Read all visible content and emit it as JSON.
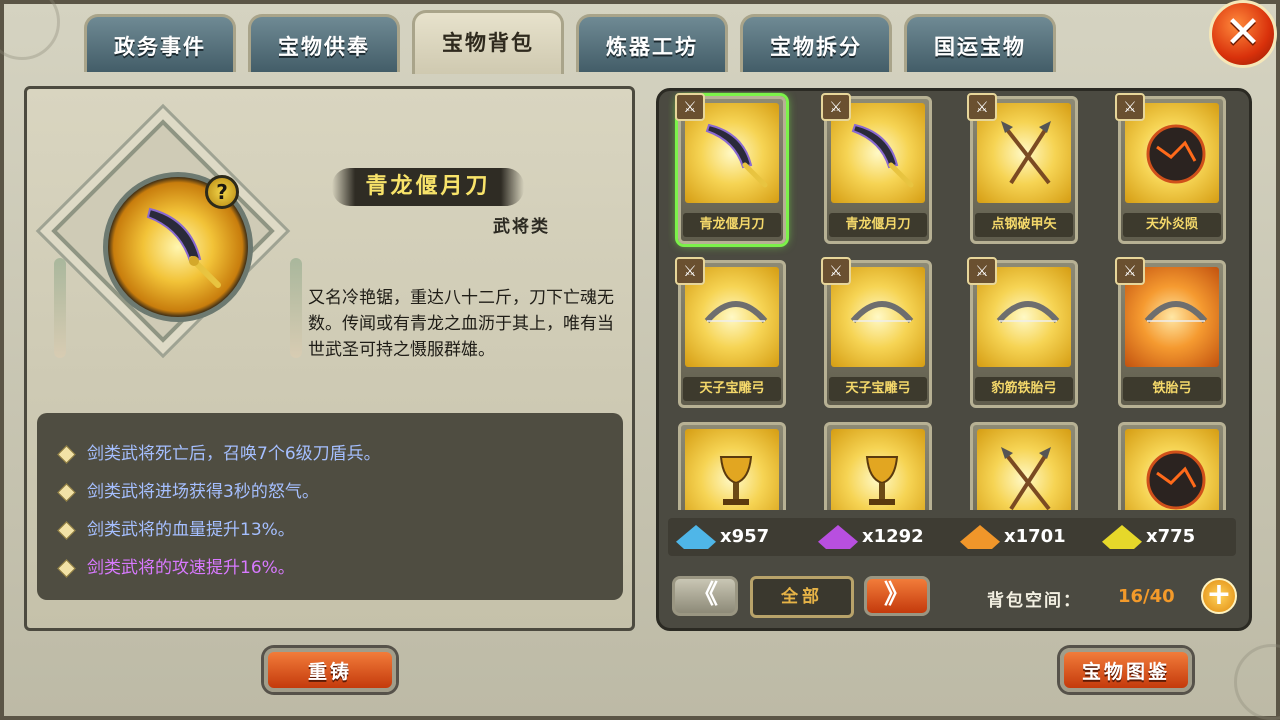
{
  "tabs": [
    {
      "label": "政务事件",
      "active": false
    },
    {
      "label": "宝物供奉",
      "active": false
    },
    {
      "label": "宝物背包",
      "active": true
    },
    {
      "label": "炼器工坊",
      "active": false
    },
    {
      "label": "宝物拆分",
      "active": false
    },
    {
      "label": "国运宝物",
      "active": false
    }
  ],
  "close_icon": "close-x",
  "detail": {
    "name": "青龙偃月刀",
    "category": "武将类",
    "help_symbol": "?",
    "description": "又名冷艳锯，重达八十二斤，刀下亡魂无数。传闻或有青龙之血沥于其上，唯有当世武圣可持之慑服群雄。",
    "effects": [
      {
        "text": "剑类武将死亡后，召唤7个6级刀盾兵。",
        "color": "#a5bfff"
      },
      {
        "text": "剑类武将进场获得3秒的怒气。",
        "color": "#a5bfff"
      },
      {
        "text": "剑类武将的血量提升13%。",
        "color": "#a5bfff"
      },
      {
        "text": "剑类武将的攻速提升16%。",
        "color": "#d879ff"
      }
    ]
  },
  "buttons": {
    "recast": "重铸",
    "catalog": "宝物图鉴"
  },
  "inventory": {
    "items": [
      {
        "name": "青龙偃月刀",
        "icon": "blade-icon",
        "selected": true
      },
      {
        "name": "青龙偃月刀",
        "icon": "blade-icon",
        "selected": false
      },
      {
        "name": "点钢破甲矢",
        "icon": "arrows-icon",
        "selected": false
      },
      {
        "name": "天外炎陨",
        "icon": "meteor-icon",
        "selected": false
      },
      {
        "name": "天子宝雕弓",
        "icon": "bow-icon",
        "selected": false
      },
      {
        "name": "天子宝雕弓",
        "icon": "bow-icon",
        "selected": false
      },
      {
        "name": "豹筋铁胎弓",
        "icon": "bow-icon",
        "selected": false
      },
      {
        "name": "铁胎弓",
        "icon": "bow-icon",
        "selected": false
      },
      {
        "name": "",
        "icon": "chalice-icon",
        "selected": false
      },
      {
        "name": "",
        "icon": "chalice-icon",
        "selected": false
      },
      {
        "name": "",
        "icon": "arrows-icon",
        "selected": false
      },
      {
        "name": "",
        "icon": "meteor-icon",
        "selected": false
      }
    ],
    "gems": [
      {
        "count": "x957",
        "color": "#4fb6e8"
      },
      {
        "count": "x1292",
        "color": "#b84fe0"
      },
      {
        "count": "x1701",
        "color": "#f0962a"
      },
      {
        "count": "x775",
        "color": "#e6d82a"
      }
    ],
    "filter": "全部",
    "capacity_label": "背包空间：",
    "capacity_value": "16/40",
    "prev_symbol": "《",
    "next_symbol": "》",
    "plus_symbol": "+"
  }
}
